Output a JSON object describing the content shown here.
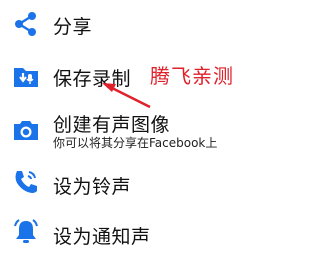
{
  "menu": {
    "items": [
      {
        "label": "分享",
        "icon": "share-icon"
      },
      {
        "label": "保存录制",
        "icon": "save-recording-icon"
      },
      {
        "label": "创建有声图像",
        "sub": "你可以将其分享在Facebook上",
        "icon": "camera-icon"
      },
      {
        "label": "设为铃声",
        "icon": "ringtone-phone-icon"
      },
      {
        "label": "设为通知声",
        "icon": "notification-bell-icon"
      }
    ]
  },
  "annotation": {
    "watermark": "腾飞亲测",
    "color": "#e0202a"
  },
  "colors": {
    "icon_blue": "#1a73e8",
    "text": "#111111"
  }
}
